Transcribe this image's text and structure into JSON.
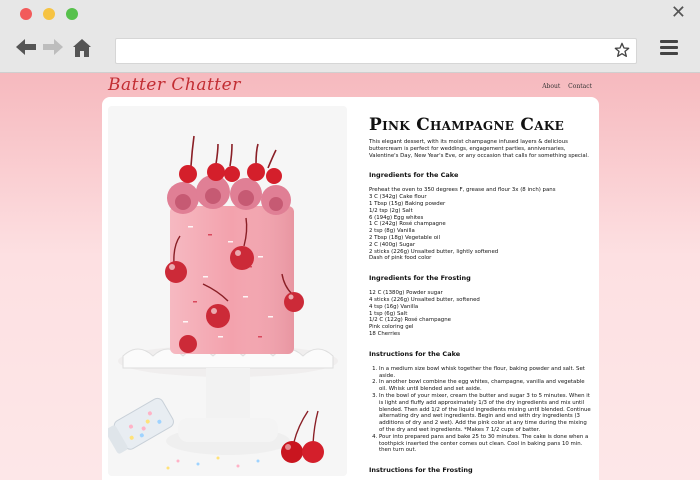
{
  "browser": {
    "close_glyph": "✕"
  },
  "site": {
    "title": "Batter Chatter",
    "nav": [
      "About",
      "Contact"
    ]
  },
  "recipe": {
    "title": "Pink Champagne Cake",
    "intro": "This elegant dessert, with its moist champagne infused layers & delicious buttercream is perfect for weddings, engagement parties, anniversaries, Valentine's Day, New Year's Eve, or any occasion that calls for something special.",
    "ingredients_cake_heading": "Ingredients for the Cake",
    "ingredients_cake": [
      "Preheat the oven to 350 degrees F, grease and flour 3x (8 inch) pans",
      "3 C (342g) Cake flour",
      "1 Tbsp (15g) Baking powder",
      "1/2 tsp (2g) Salt",
      "6 (194g) Egg whites",
      "1 C (242g) Rosé champagne",
      "2 tsp (8g) Vanilla",
      "2 Tbsp (18g) Vegetable oil",
      "2 C (400g) Sugar",
      "2 sticks (226g) Unsalted butter, lightly softened",
      "Dash of pink food color"
    ],
    "ingredients_frosting_heading": "Ingredients for the Frosting",
    "ingredients_frosting": [
      "12 C (1380g) Powder sugar",
      "4 sticks (226g) Unsalted butter, softened",
      "4 tsp (16g) Vanilla",
      "1 tsp (6g) Salt",
      "1/2 C (122g) Rosé champagne",
      "Pink coloring gel",
      "18 Cherries"
    ],
    "instructions_cake_heading": "Instructions for the Cake",
    "instructions_cake": [
      "In a medium size bowl whisk together the flour, baking powder and salt. Set aside.",
      "In another bowl combine the egg whites, champagne, vanilla and vegetable oil. Whisk until blended and set aside.",
      "In the bowl of your mixer, cream the butter and sugar 3 to 5 minutes. When it is light and fluffy add approximately 1/3 of the dry ingredients and mix until blended. Then add 1/2 of the liquid ingredients mixing until blended. Continue alternating dry and wet ingredients. Begin and end with dry ingredients (3 additions of dry and 2 wet). Add the pink color at any time during the mixing of the dry and wet ingredients. *Makes 7 1/2 cups of batter.",
      "Pour into prepared pans and bake 25 to 30 minutes. The cake is done when a toothpick inserted the center comes out clean. Cool in baking pans 10 min. then turn out."
    ],
    "instructions_frosting_heading": "Instructions for the Frosting"
  },
  "colors": {
    "page_pink": "#fbc9cc",
    "brand_red": "#c22d33",
    "cake_pink": "#f3a2ad",
    "cherry_red": "#c9151f"
  }
}
